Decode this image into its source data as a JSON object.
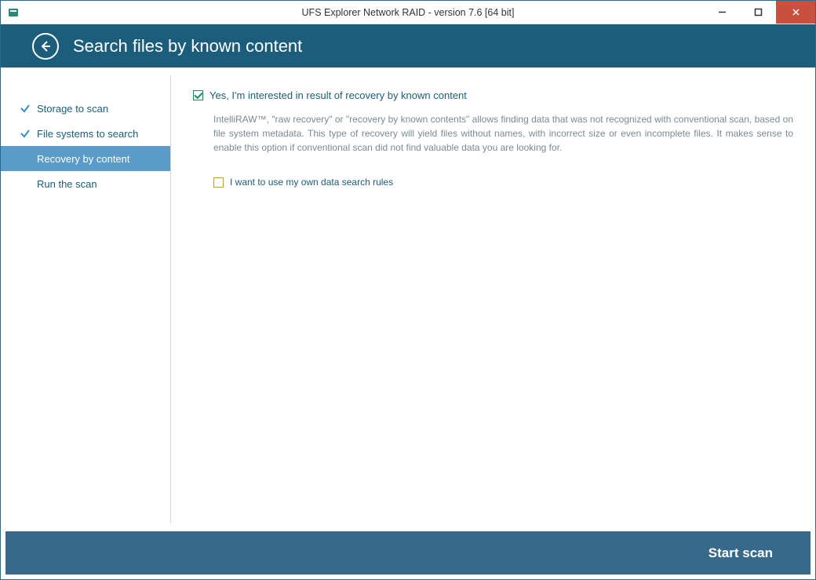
{
  "window": {
    "title": "UFS Explorer Network RAID - version 7.6 [64 bit]"
  },
  "header": {
    "title": "Search files by known content"
  },
  "sidebar": {
    "steps": [
      {
        "label": "Storage to scan",
        "state": "done"
      },
      {
        "label": "File systems to search",
        "state": "done"
      },
      {
        "label": "Recovery by content",
        "state": "active"
      },
      {
        "label": "Run the scan",
        "state": "future"
      }
    ]
  },
  "content": {
    "main_checkbox_label": "Yes, I'm interested in result of recovery by known content",
    "main_checkbox_checked": true,
    "description": "IntelliRAW™, \"raw recovery\" or \"recovery by known contents\" allows finding data that was not recognized with conventional scan, based on file system metadata. This type of recovery will yield files without names, with incorrect size or even incomplete files. It makes sense to enable this option if conventional scan did not find valuable data you are looking for.",
    "sub_checkbox_label": "I want to use my own data search rules",
    "sub_checkbox_checked": false
  },
  "footer": {
    "start_label": "Start scan"
  }
}
